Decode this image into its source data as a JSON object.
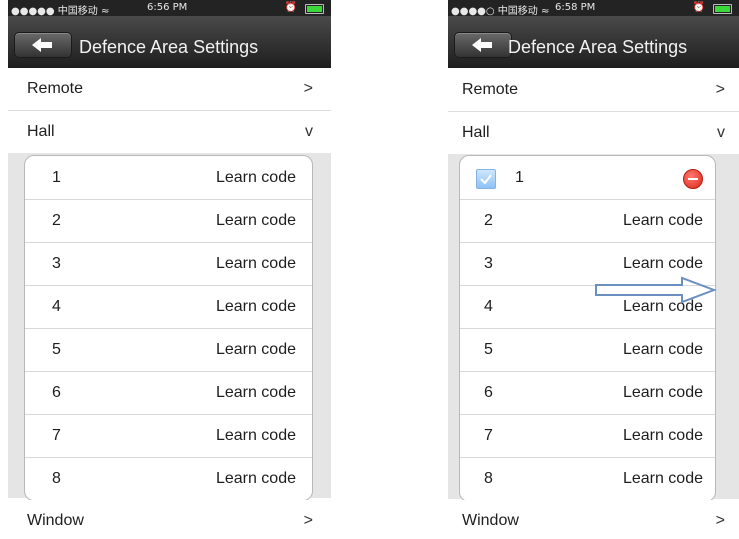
{
  "screens": [
    {
      "status": {
        "carrier": "●●●●● 中国移动 ≈",
        "time": "6:56 PM"
      },
      "title": "Defence Area Settings",
      "rows": [
        {
          "label": "Remote",
          "marker": ">"
        },
        {
          "label": "Hall",
          "marker": "v"
        }
      ],
      "items": [
        {
          "num": "1",
          "action": "Learn code"
        },
        {
          "num": "2",
          "action": "Learn code"
        },
        {
          "num": "3",
          "action": "Learn code"
        },
        {
          "num": "4",
          "action": "Learn code"
        },
        {
          "num": "5",
          "action": "Learn code"
        },
        {
          "num": "6",
          "action": "Learn code"
        },
        {
          "num": "7",
          "action": "Learn code"
        },
        {
          "num": "8",
          "action": "Learn code"
        }
      ],
      "footer_row": {
        "label": "Window",
        "marker": ">"
      }
    },
    {
      "status": {
        "carrier": "●●●●○ 中国移动 ≈",
        "time": "6:58 PM"
      },
      "title": "Defence Area Settings",
      "rows": [
        {
          "label": "Remote",
          "marker": ">"
        },
        {
          "label": "Hall",
          "marker": "v"
        }
      ],
      "items": [
        {
          "num": "1",
          "action": "",
          "checked": true
        },
        {
          "num": "2",
          "action": "Learn code"
        },
        {
          "num": "3",
          "action": "Learn code"
        },
        {
          "num": "4",
          "action": "Learn code"
        },
        {
          "num": "5",
          "action": "Learn code"
        },
        {
          "num": "6",
          "action": "Learn code"
        },
        {
          "num": "7",
          "action": "Learn code"
        },
        {
          "num": "8",
          "action": "Learn code"
        }
      ],
      "footer_row": {
        "label": "Window",
        "marker": ">"
      }
    }
  ],
  "icons": {
    "back": "back-arrow-icon",
    "alarm": "alarm-clock-icon",
    "battery": "battery-icon",
    "checkbox": "checkbox-icon",
    "delete": "delete-icon",
    "swipe": "swipe-right-arrow-icon"
  },
  "colors": {
    "battery": "#3ad83a",
    "delete": "#d8271a",
    "checkbox": "#8cc2f5",
    "arrow": "#6a8fc0"
  }
}
